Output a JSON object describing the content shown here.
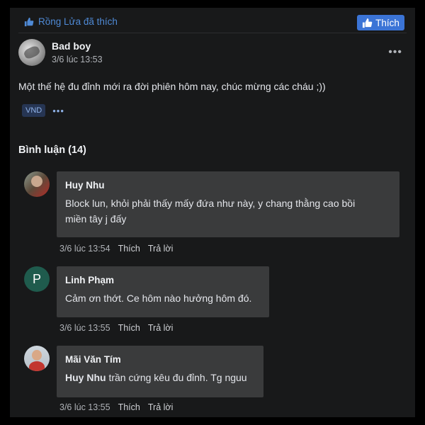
{
  "header": {
    "liked_text": "Rồng Lửa đã thích",
    "like_button_label": "Thích"
  },
  "post": {
    "author": "Bad boy",
    "time": "3/6 lúc 13:53",
    "text": "Một thế hệ đu đỉnh mới ra đời phiên hôm nay, chúc mừng các cháu ;))",
    "tag": "VND",
    "tag_more": "•••",
    "more_menu": "•••"
  },
  "comments_section": {
    "title": "Bình luận (14)",
    "comments": [
      {
        "name": "Huy Nhu",
        "line1": "Block lun, khỏi phải thấy mấy đứa như này, y chang thằng cao bồi",
        "line2": "miền tây j đấy",
        "time": "3/6 lúc 13:54",
        "like": "Thích",
        "reply": "Trả lời"
      },
      {
        "name": "Linh Phạm",
        "avatar_letter": "P",
        "line1": "Cảm ơn thớt. Ce hôm nào hưởng hôm đó.",
        "time": "3/6 lúc 13:55",
        "like": "Thích",
        "reply": "Trả lời"
      },
      {
        "name": "Mãi Văn Tím",
        "mention": "Huy Nhu",
        "line1": " trần cứng kêu đu đỉnh. Tg nguu",
        "time": "3/6 lúc 13:55",
        "like": "Thích",
        "reply": "Trả lời"
      }
    ]
  },
  "colors": {
    "background": "#18191a",
    "bubble": "#3a3b3c",
    "accent": "#3b74d6"
  }
}
